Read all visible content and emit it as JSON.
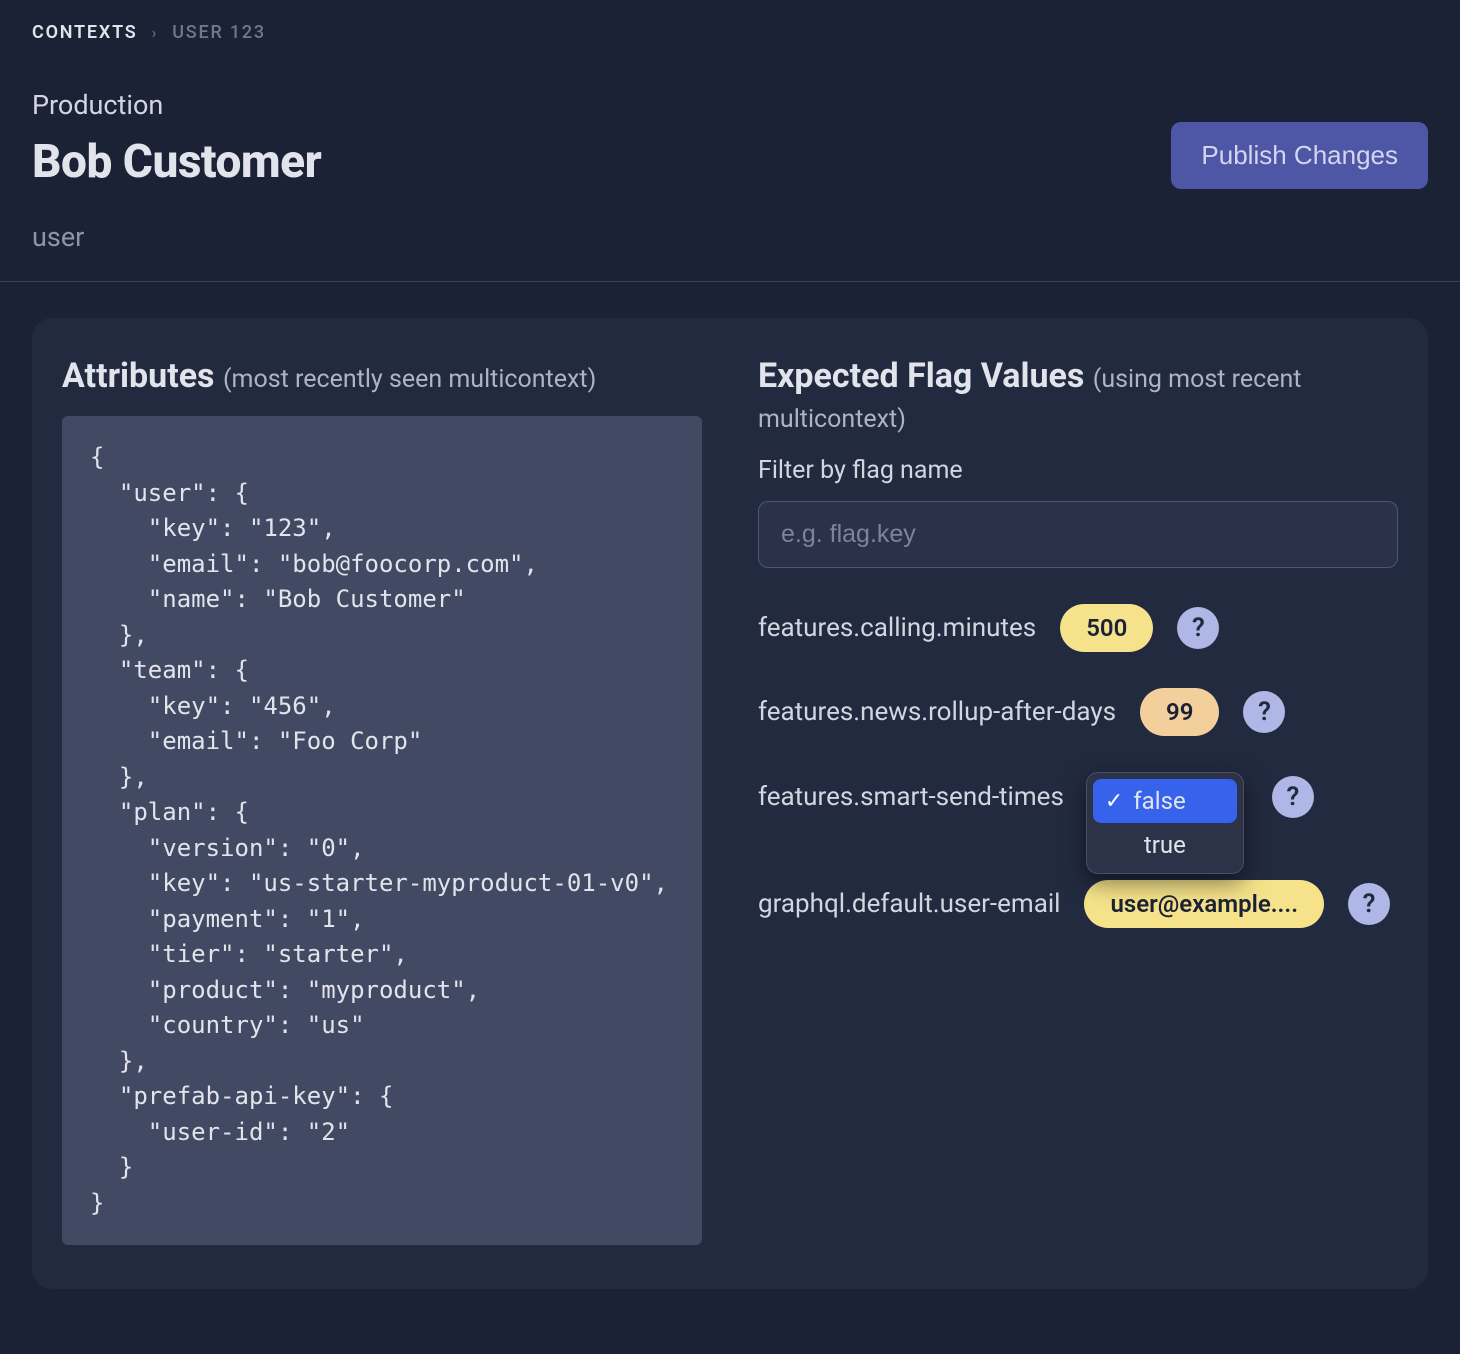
{
  "breadcrumb": {
    "root": "Contexts",
    "leaf": "User 123"
  },
  "header": {
    "env": "Production",
    "title": "Bob Customer",
    "subtype": "user",
    "publish": "Publish Changes"
  },
  "attributes": {
    "heading": "Attributes",
    "note": "(most recently seen multicontext)",
    "json": "{\n  \"user\": {\n    \"key\": \"123\",\n    \"email\": \"bob@foocorp.com\",\n    \"name\": \"Bob Customer\"\n  },\n  \"team\": {\n    \"key\": \"456\",\n    \"email\": \"Foo Corp\"\n  },\n  \"plan\": {\n    \"version\": \"0\",\n    \"key\": \"us-starter-myproduct-01-v0\",\n    \"payment\": \"1\",\n    \"tier\": \"starter\",\n    \"product\": \"myproduct\",\n    \"country\": \"us\"\n  },\n  \"prefab-api-key\": {\n    \"user-id\": \"2\"\n  }\n}"
  },
  "expected": {
    "heading": "Expected Flag Values",
    "note": "(using most recent multicontext)",
    "filter_label": "Filter by flag name",
    "filter_placeholder": "e.g. flag.key",
    "help_icon": "?",
    "flags": [
      {
        "name": "features.calling.minutes",
        "value": "500",
        "style": "yellow"
      },
      {
        "name": "features.news.rollup-after-days",
        "value": "99",
        "style": "peach"
      },
      {
        "name": "features.smart-send-times",
        "value_dropdown": {
          "selected": "false",
          "options": [
            "false",
            "true"
          ]
        }
      },
      {
        "name": "graphql.default.user-email",
        "value": "user@example....",
        "style": "yellow",
        "truncate": true
      }
    ]
  }
}
